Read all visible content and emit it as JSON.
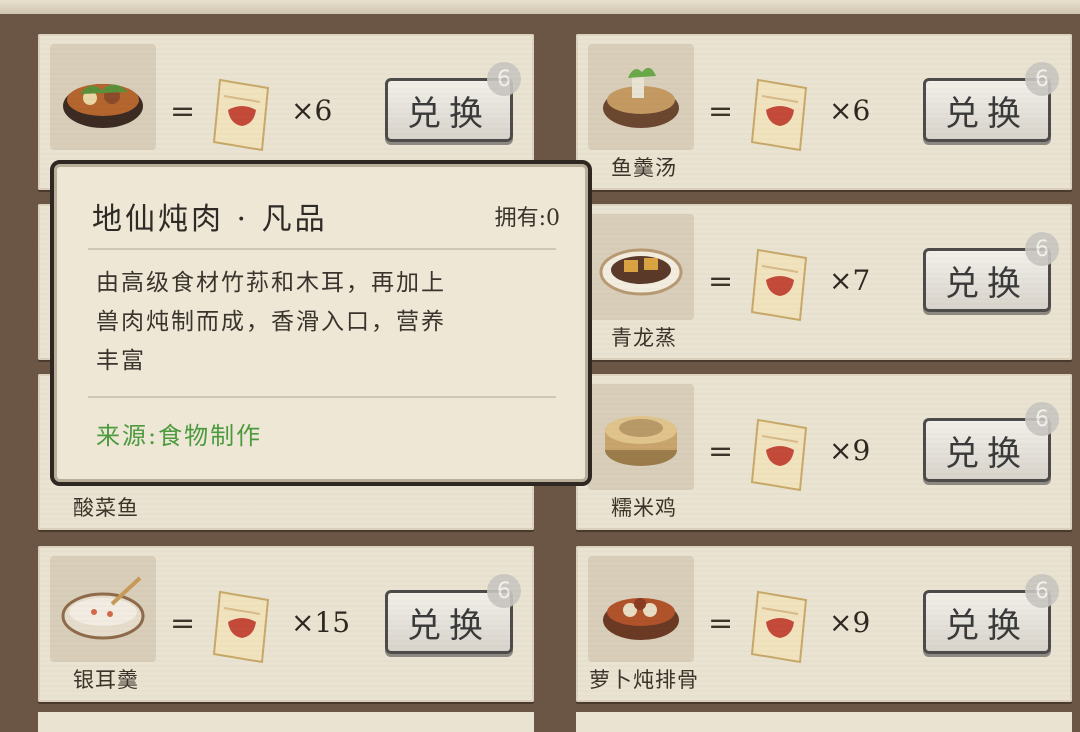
{
  "tooltip": {
    "title": "地仙炖肉 · 凡品",
    "owned": "拥有:0",
    "description_lines": [
      "由高级食材竹荪和木耳，再加上",
      "兽肉炖制而成，香滑入口，营养",
      "丰富"
    ],
    "source": "来源:食物制作"
  },
  "cards": [
    {
      "name": "",
      "qty": "×6",
      "button": "兑换",
      "limit": "6",
      "dish_icon": "stew-pot-icon",
      "sauce": "#b5652e",
      "accent": "#5c8f3a"
    },
    {
      "name": "鱼羹汤",
      "qty": "×6",
      "button": "兑换",
      "limit": "6",
      "dish_icon": "fish-soup-pot-icon",
      "sauce": "#c49a62",
      "accent": "#6aa848"
    },
    {
      "name": "",
      "qty": "",
      "button": "",
      "limit": "",
      "dish_icon": "",
      "sauce": "#ffffff",
      "accent": "#ffffff"
    },
    {
      "name": "青龙蒸",
      "qty": "×7",
      "button": "兑换",
      "limit": "6",
      "dish_icon": "steamed-tofu-plate-icon",
      "sauce": "#d9a441",
      "accent": "#5b3a2a"
    },
    {
      "name": "酸菜鱼",
      "qty": "",
      "button": "",
      "limit": "",
      "dish_icon": "",
      "sauce": "#ffffff",
      "accent": "#ffffff"
    },
    {
      "name": "糯米鸡",
      "qty": "×9",
      "button": "兑换",
      "limit": "6",
      "dish_icon": "bamboo-steamer-icon",
      "sauce": "#c9a56d",
      "accent": "#9b7c4a"
    },
    {
      "name": "银耳羹",
      "qty": "×15",
      "button": "兑换",
      "limit": "6",
      "dish_icon": "porridge-bowl-icon",
      "sauce": "#f2ece2",
      "accent": "#d26a4a"
    },
    {
      "name": "萝卜炖排骨",
      "qty": "×9",
      "button": "兑换",
      "limit": "6",
      "dish_icon": "rib-stew-pot-icon",
      "sauce": "#b0532b",
      "accent": "#e8dcc4"
    }
  ],
  "equals": "=",
  "colors": {
    "background": "#6b5544",
    "card": "#eae3d2",
    "button_border": "#4d4c4a",
    "source_green": "#4c9a3e"
  }
}
